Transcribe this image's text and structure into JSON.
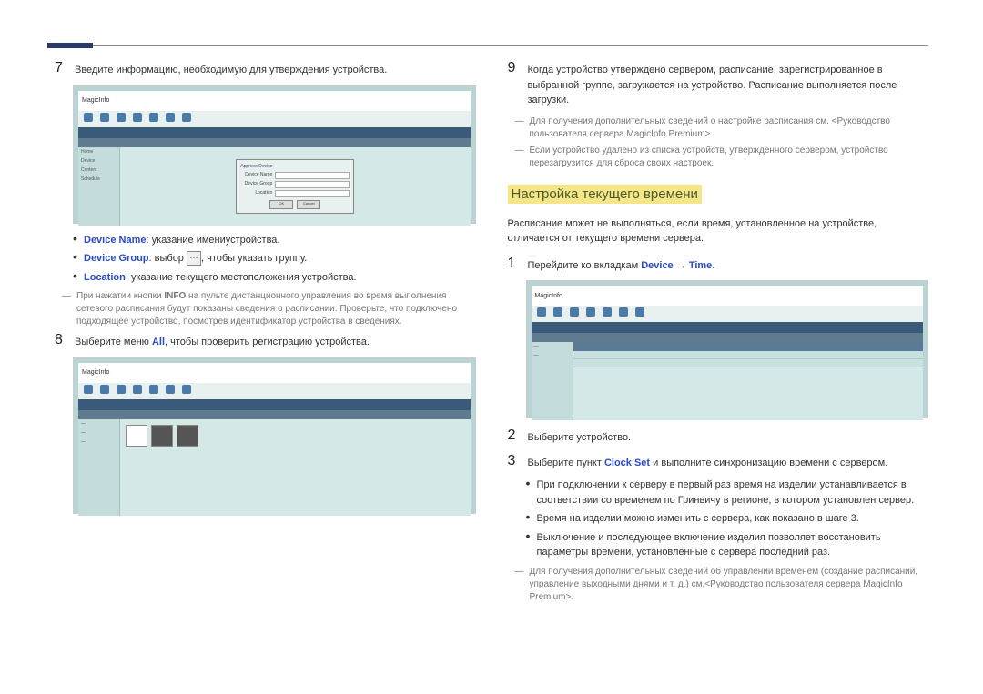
{
  "left": {
    "step7": {
      "num": "7",
      "text": "Введите информацию, необходимую для утверждения устройства."
    },
    "screenshot1": {
      "logo": "MagicInfo",
      "sidebar_items": [
        "Home",
        "Device",
        "Content",
        "Schedule"
      ],
      "dialog": {
        "title": "Approve Device",
        "row1_label": "Device Name",
        "row2_label": "Device Group",
        "row3_label": "Location",
        "btn_ok": "OK",
        "btn_cancel": "Cancel"
      }
    },
    "bullets": {
      "b1_key": "Device Name",
      "b1_text": ": указание имениустройства.",
      "b2_key": "Device Group",
      "b2_pre": ": выбор ",
      "b2_icon": "⋯",
      "b2_post": ", чтобы указать группу.",
      "b3_key": "Location",
      "b3_text": ": указание текущего местоположения устройства."
    },
    "note1_pre": "При нажатии кнопки ",
    "note1_bold": "INFO",
    "note1_post": " на пульте дистанционного управления во время выполнения сетевого расписания будут показаны сведения о расписании. Проверьте, что подключено подходящее устройство, посмотрев идентификатор устройства в сведениях.",
    "step8": {
      "num": "8",
      "pre": "Выберите меню ",
      "kw": "All",
      "post": ", чтобы проверить регистрацию устройства."
    },
    "screenshot2": {
      "logo": "MagicInfo"
    }
  },
  "right": {
    "step9": {
      "num": "9",
      "text": "Когда устройство утверждено сервером, расписание, зарегистрированное в выбранной группе, загружается на устройство. Расписание выполняется после загрузки."
    },
    "note2": "Для получения дополнительных сведений о настройке расписания см. <Руководство пользователя сервера MagicInfo Premium>.",
    "note3": "Если устройство удалено из списка устройств, утвержденного сервером, устройство перезагрузится для сброса своих настроек.",
    "heading": "Настройка текущего времени",
    "intro": "Расписание может не выполняться, если время, установленное на устройстве, отличается от текущего времени сервера.",
    "step1": {
      "num": "1",
      "pre": "Перейдите ко вкладкам ",
      "kw1": "Device",
      "arrow": " → ",
      "kw2": "Time",
      "post": "."
    },
    "screenshot3": {
      "logo": "MagicInfo"
    },
    "step2": {
      "num": "2",
      "text": "Выберите устройство."
    },
    "step3": {
      "num": "3",
      "pre": "Выберите пункт ",
      "kw": "Clock Set",
      "post": " и выполните синхронизацию времени с сервером."
    },
    "bullets2": {
      "b1": "При подключении к серверу в первый раз время на изделии устанавливается в соответствии со временем по Гринвичу в регионе, в котором установлен сервер.",
      "b2": "Время на изделии можно изменить с сервера, как показано в шаге 3.",
      "b3": "Выключение и последующее включение изделия позволяет восстановить параметры времени, установленные с сервера последний раз."
    },
    "note4": "Для получения дополнительных сведений об управлении временем (создание расписаний, управление выходными днями и т. д.) см.<Руководство пользователя сервера MagicInfo Premium>."
  }
}
